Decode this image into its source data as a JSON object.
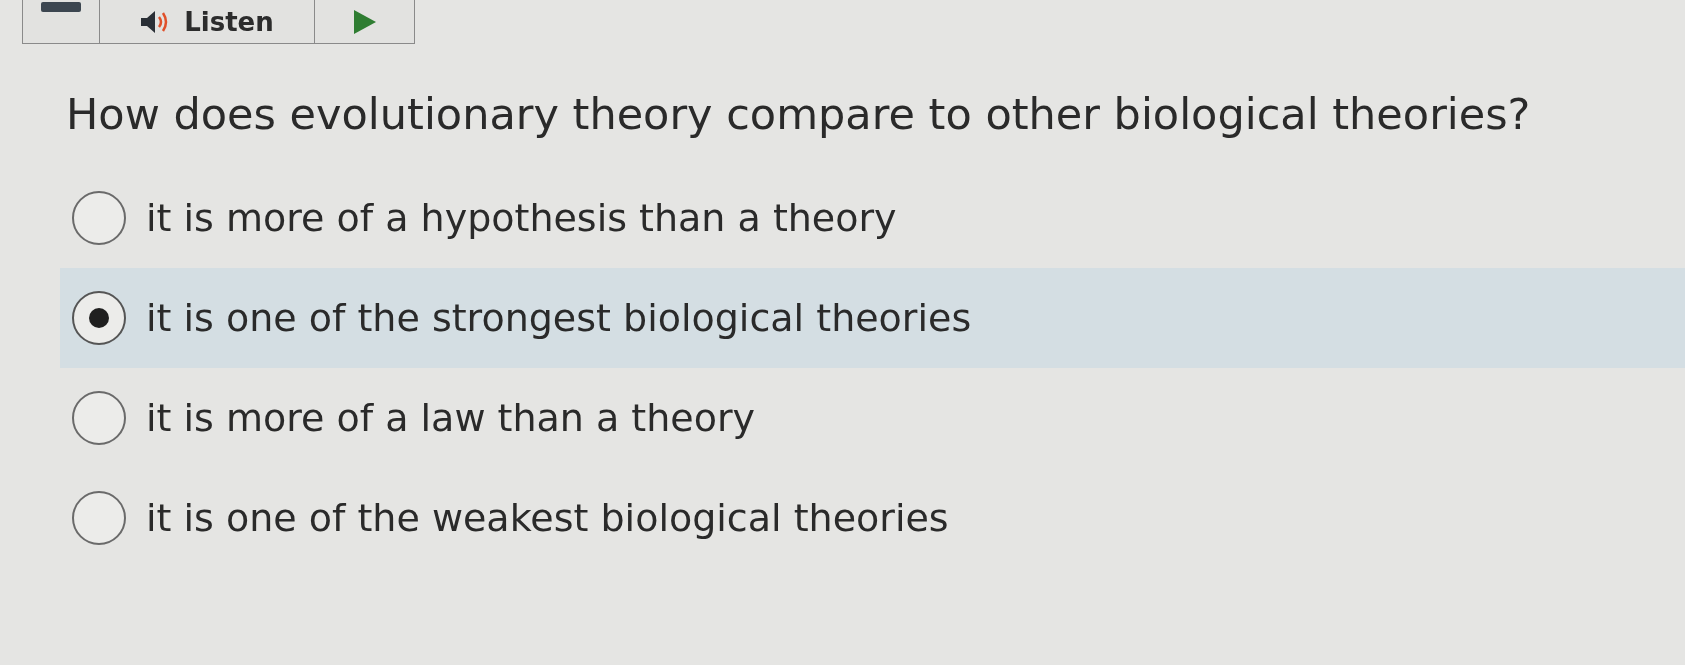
{
  "toolbar": {
    "listen_label": "Listen"
  },
  "question": {
    "text": "How does evolutionary theory compare to other biological theories?",
    "options": [
      {
        "label": "it is more of a hypothesis than a theory",
        "selected": false
      },
      {
        "label": "it is one of the strongest biological theories",
        "selected": true
      },
      {
        "label": "it is more of a law than a theory",
        "selected": false
      },
      {
        "label": "it is one of the weakest biological theories",
        "selected": false
      }
    ]
  }
}
